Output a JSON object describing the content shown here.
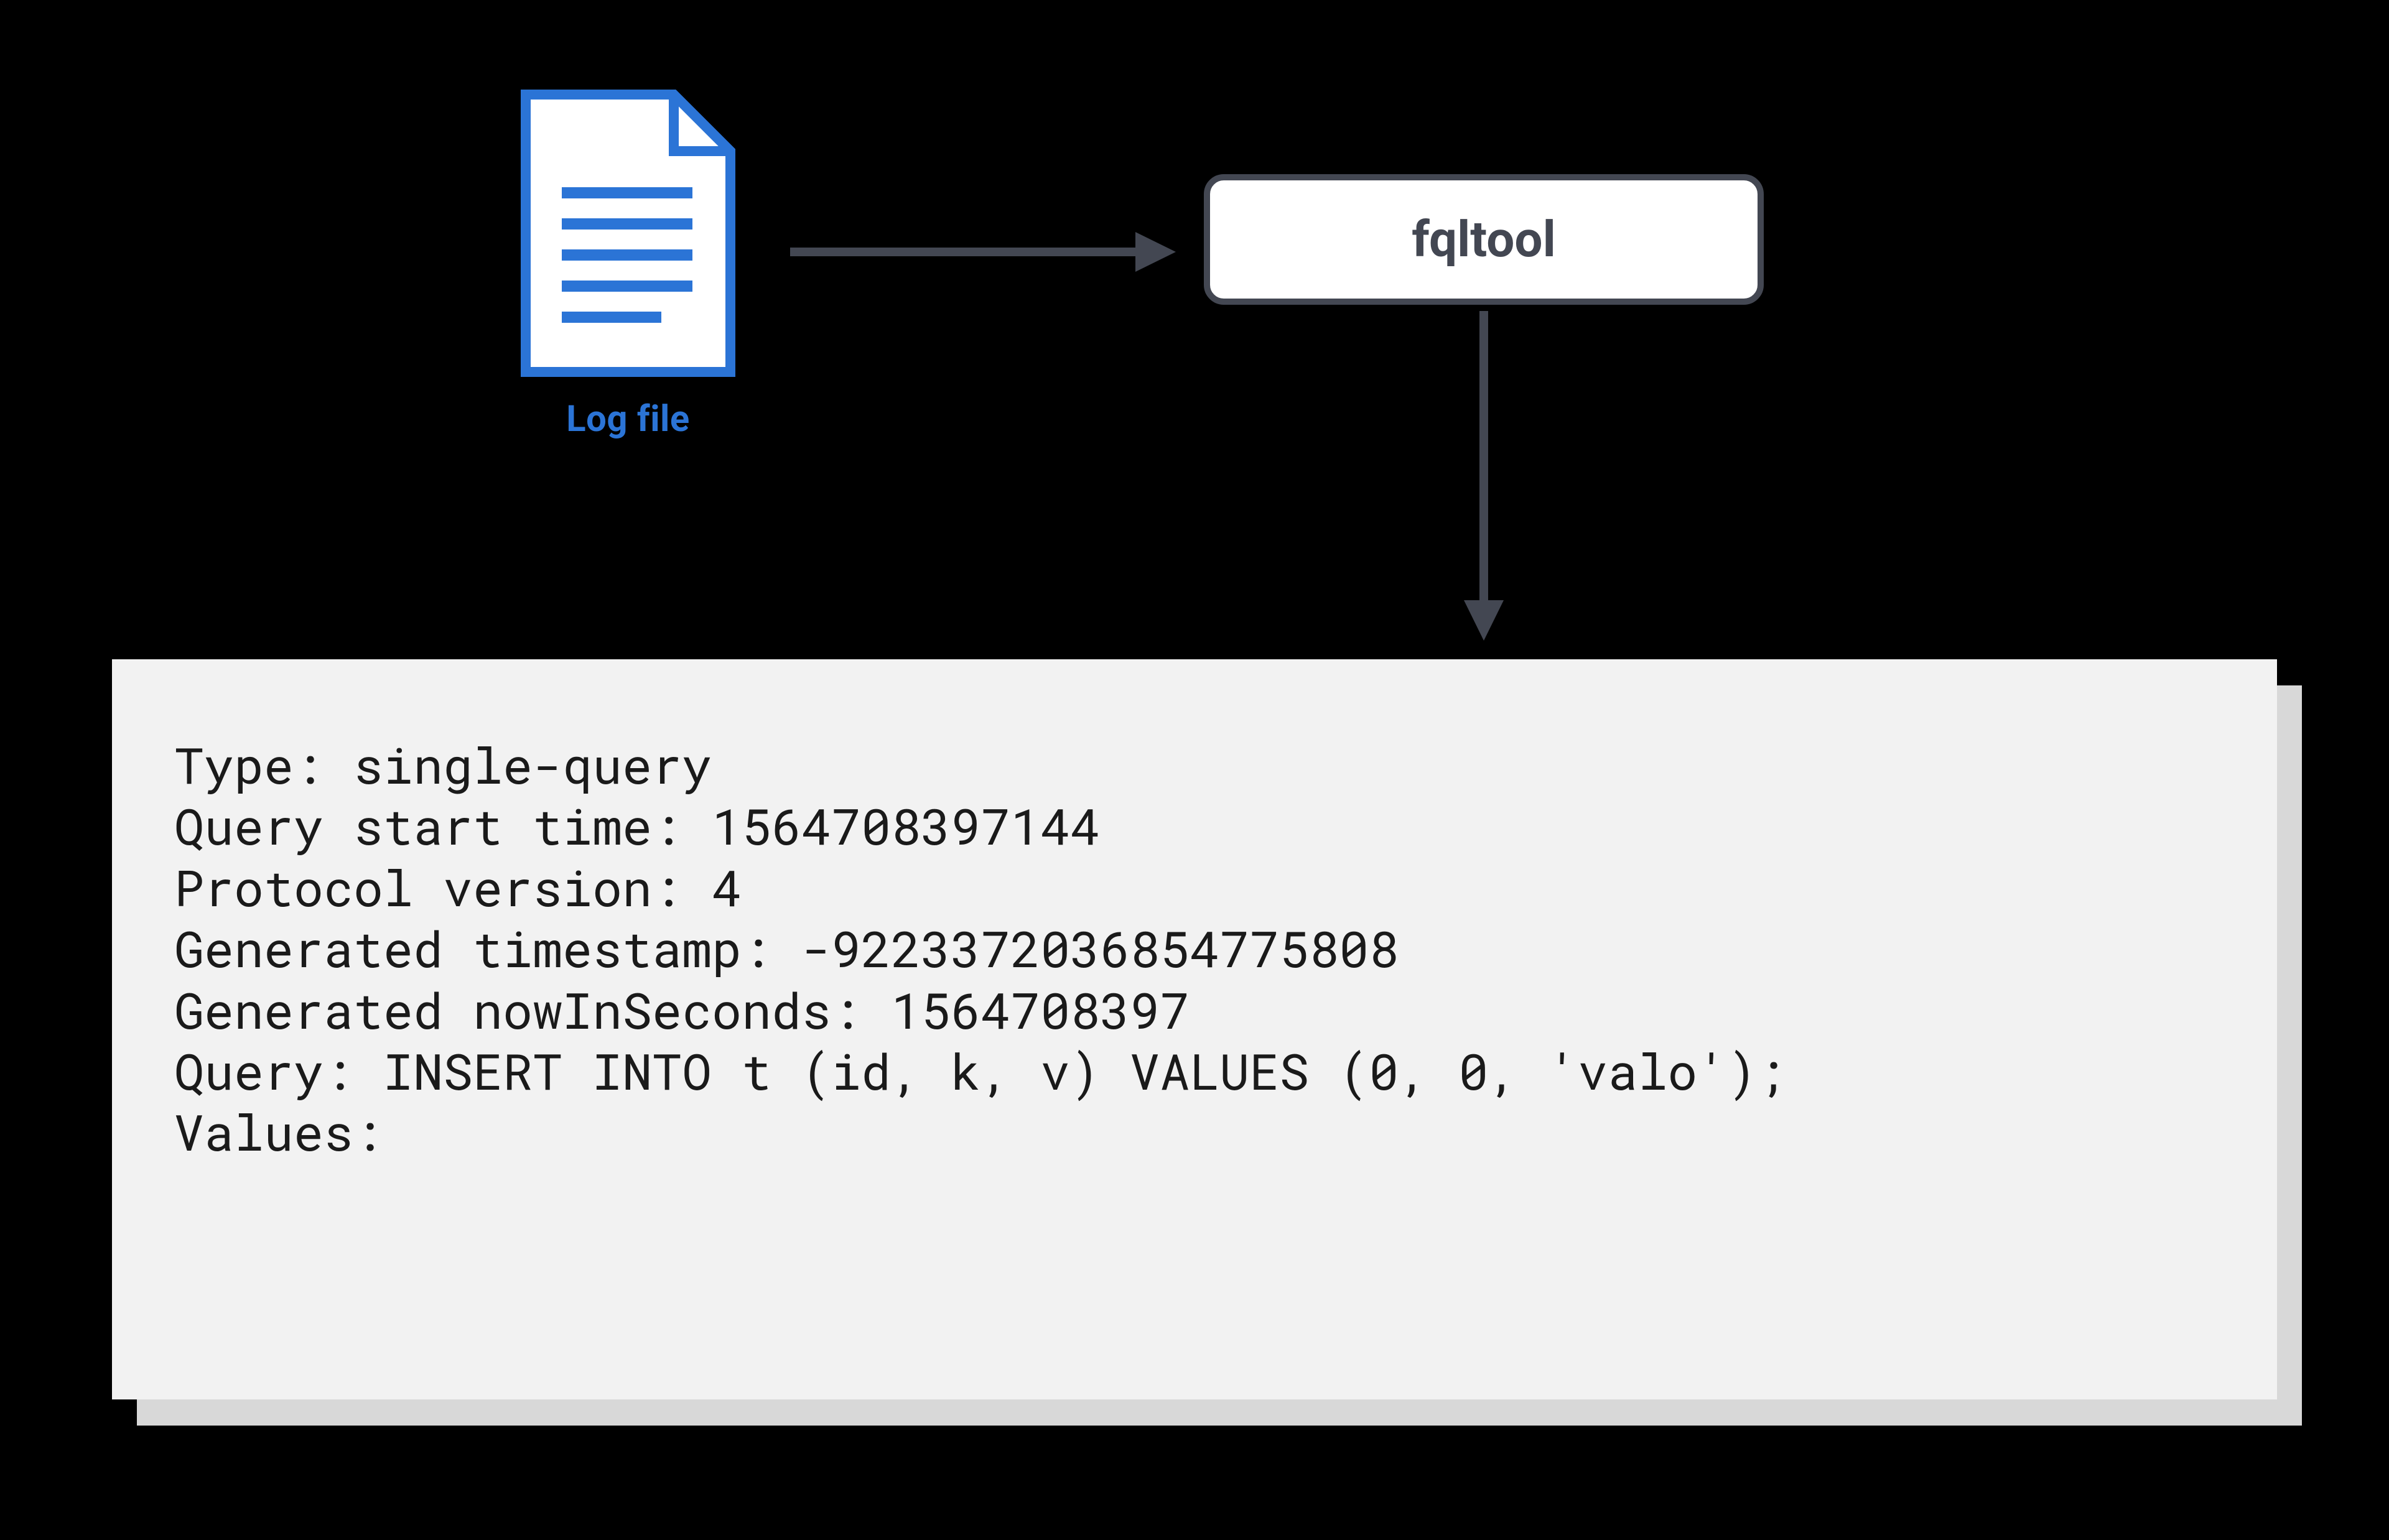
{
  "diagram": {
    "log_file_label": "Log file",
    "tool_label": "fqltool"
  },
  "output": {
    "lines": [
      "Type: single-query",
      "Query start time: 1564708397144",
      "Protocol version: 4",
      "Generated timestamp: -9223372036854775808",
      "Generated nowInSeconds: 1564708397",
      "Query: INSERT INTO t (id, k, v) VALUES (0, 0, 'valo');",
      "Values:"
    ]
  },
  "colors": {
    "file_blue": "#2b74d6",
    "box_stroke": "#434752",
    "panel_bg": "#f2f2f2",
    "shadow": "#d8d8d8"
  }
}
